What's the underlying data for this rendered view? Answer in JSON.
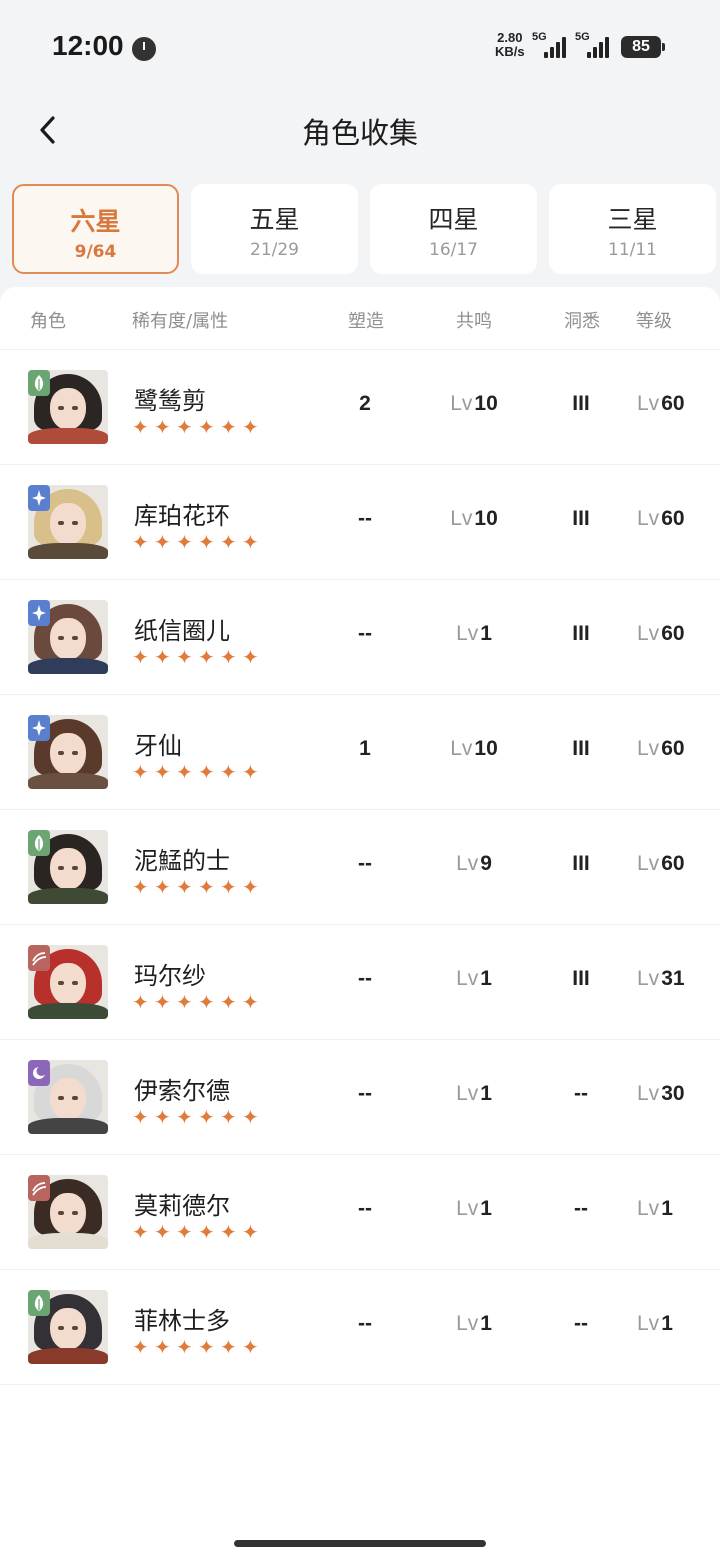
{
  "status_bar": {
    "time": "12:00",
    "net_speed_value": "2.80",
    "net_speed_unit": "KB/s",
    "sim1": "5G",
    "sim2": "5G",
    "battery": "85"
  },
  "header": {
    "title": "角色收集",
    "back_icon": "chevron-left-icon"
  },
  "tabs": [
    {
      "label": "六星",
      "count": "9/64",
      "active": true
    },
    {
      "label": "五星",
      "count": "21/29",
      "active": false
    },
    {
      "label": "四星",
      "count": "16/17",
      "active": false
    },
    {
      "label": "三星",
      "count": "11/11",
      "active": false
    }
  ],
  "table": {
    "columns": [
      "角色",
      "稀有度/属性",
      "塑造",
      "共鸣",
      "洞悉",
      "等级"
    ],
    "lv_prefix": "Lv",
    "rows": [
      {
        "name": "鹭鸶剪",
        "element": "leaf-icon",
        "stars": 6,
        "shaping": "2",
        "resonance": "10",
        "insight": "III",
        "level": "60"
      },
      {
        "name": "库珀花环",
        "element": "star-sparkle-icon",
        "stars": 6,
        "shaping": "--",
        "resonance": "10",
        "insight": "III",
        "level": "60"
      },
      {
        "name": "纸信圈儿",
        "element": "star-sparkle-icon",
        "stars": 6,
        "shaping": "--",
        "resonance": "1",
        "insight": "III",
        "level": "60"
      },
      {
        "name": "牙仙",
        "element": "star-sparkle-icon",
        "stars": 6,
        "shaping": "1",
        "resonance": "10",
        "insight": "III",
        "level": "60"
      },
      {
        "name": "泥鯭的士",
        "element": "leaf-icon",
        "stars": 6,
        "shaping": "--",
        "resonance": "9",
        "insight": "III",
        "level": "60"
      },
      {
        "name": "玛尔纱",
        "element": "claw-icon",
        "stars": 6,
        "shaping": "--",
        "resonance": "1",
        "insight": "III",
        "level": "31"
      },
      {
        "name": "伊索尔德",
        "element": "moon-icon",
        "stars": 6,
        "shaping": "--",
        "resonance": "1",
        "insight": "--",
        "level": "30"
      },
      {
        "name": "莫莉德尔",
        "element": "claw-icon",
        "stars": 6,
        "shaping": "--",
        "resonance": "1",
        "insight": "--",
        "level": "1"
      },
      {
        "name": "菲林士多",
        "element": "leaf-icon",
        "stars": 6,
        "shaping": "--",
        "resonance": "1",
        "insight": "--",
        "level": "1"
      }
    ]
  },
  "colors": {
    "accent": "#d9783e",
    "star": "#e07b3b",
    "leaf": "#6aa572",
    "star_sparkle": "#5a7fce",
    "claw": "#b8655f",
    "moon": "#8a67b8"
  }
}
